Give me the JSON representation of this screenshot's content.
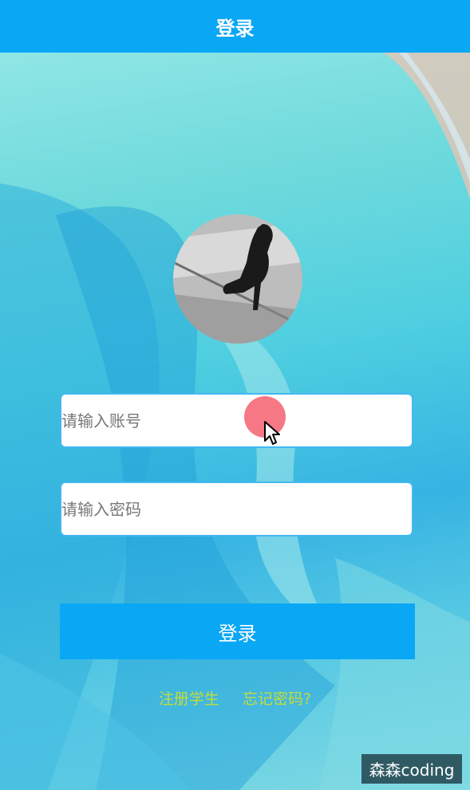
{
  "header": {
    "title": "登录"
  },
  "form": {
    "account_placeholder": "请输入账号",
    "password_placeholder": "请输入密码",
    "login_label": "登录"
  },
  "links": {
    "register": "注册学生",
    "forgot": "忘记密码?"
  },
  "watermark": "森森coding",
  "colors": {
    "primary": "#0aa7f5",
    "link": "#d4df2a",
    "cursor_highlight": "#f4606e"
  }
}
